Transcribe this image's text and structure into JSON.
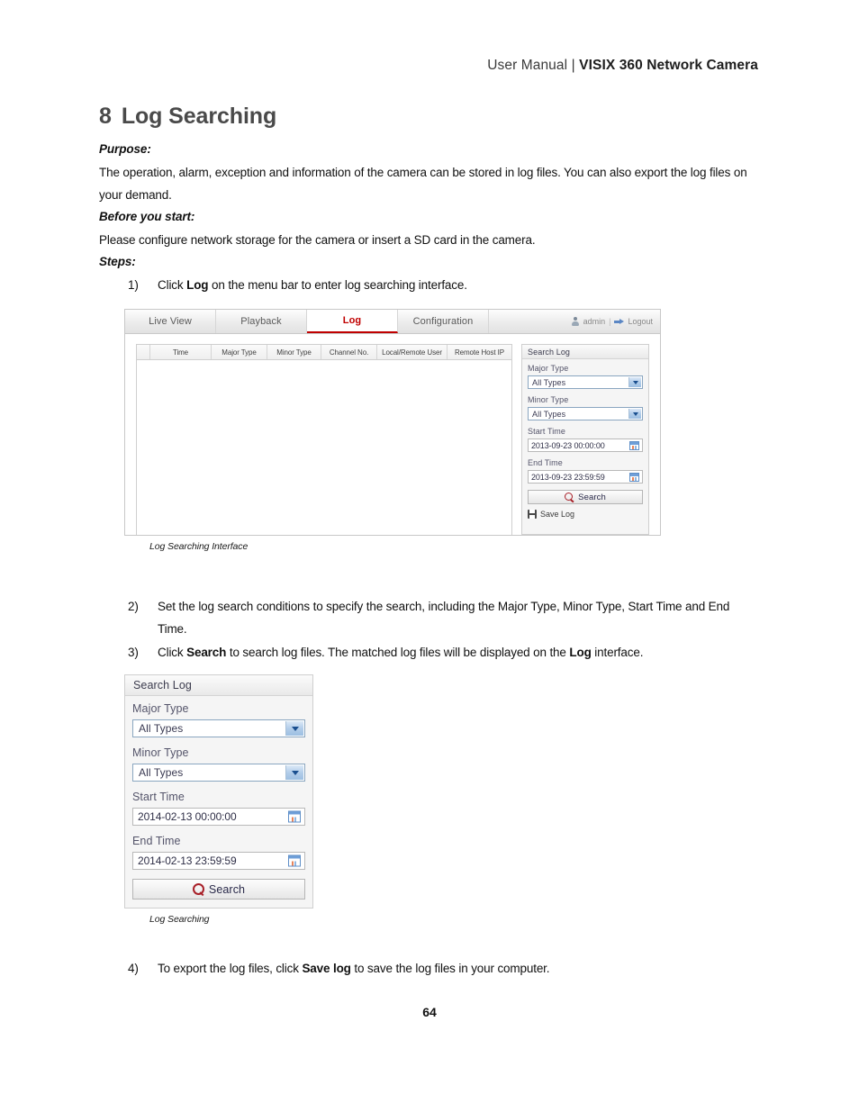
{
  "header": {
    "prefix": "User Manual",
    "divider": "|",
    "title": "VISIX 360 Network Camera"
  },
  "chapter": {
    "number": "8",
    "title": "Log Searching"
  },
  "sections": {
    "purpose_label": "Purpose:",
    "purpose_text": "The operation, alarm, exception and information of the camera can be stored in log files. You can also export the log files on your demand.",
    "before_label": "Before you start:",
    "before_text": "Please configure network storage for the camera or insert a SD card in the camera.",
    "steps_label": "Steps:"
  },
  "steps": {
    "s1": {
      "marker": "1)",
      "part1": "Click ",
      "bold1": "Log",
      "part2": " on the menu bar to enter log searching interface."
    },
    "s2": {
      "marker": "2)",
      "text": "Set the log search conditions to specify the search, including the Major Type, Minor Type, Start Time and End Time."
    },
    "s3": {
      "marker": "3)",
      "part1": "Click ",
      "bold1": "Search",
      "part2": " to search log files. The matched log files will be displayed on the ",
      "bold2": "Log",
      "part3": " interface."
    },
    "s4": {
      "marker": "4)",
      "part1": "To export the log files, click ",
      "bold1": "Save log",
      "part2": " to save the log files in your computer."
    }
  },
  "captions": {
    "fig1": "Log Searching Interface",
    "fig2": "Log Searching"
  },
  "figure1": {
    "menubar": {
      "tabs": [
        {
          "label": "Live View",
          "active": false
        },
        {
          "label": "Playback",
          "active": false
        },
        {
          "label": "Log",
          "active": true
        },
        {
          "label": "Configuration",
          "active": false
        }
      ],
      "user": "admin",
      "separator": "|",
      "logout": "Logout"
    },
    "table_headers": [
      "",
      "Time",
      "Major Type",
      "Minor Type",
      "Channel No.",
      "Local/Remote User",
      "Remote Host IP"
    ],
    "panel": {
      "title": "Search Log",
      "major_type_label": "Major Type",
      "major_type_value": "All Types",
      "minor_type_label": "Minor Type",
      "minor_type_value": "All Types",
      "start_time_label": "Start Time",
      "start_time_value": "2013-09-23 00:00:00",
      "end_time_label": "End Time",
      "end_time_value": "2013-09-23 23:59:59",
      "search_button": "Search",
      "save_log": "Save Log"
    }
  },
  "figure2": {
    "title": "Search Log",
    "major_type_label": "Major Type",
    "major_type_value": "All Types",
    "minor_type_label": "Minor Type",
    "minor_type_value": "All Types",
    "start_time_label": "Start Time",
    "start_time_value": "2014-02-13 00:00:00",
    "end_time_label": "End Time",
    "end_time_value": "2014-02-13 23:59:59",
    "search_button": "Search"
  },
  "page_number": "64",
  "colors": {
    "accent_red": "#c00000",
    "heading_gray": "#4a4a4a",
    "label_slate": "#54546a"
  }
}
